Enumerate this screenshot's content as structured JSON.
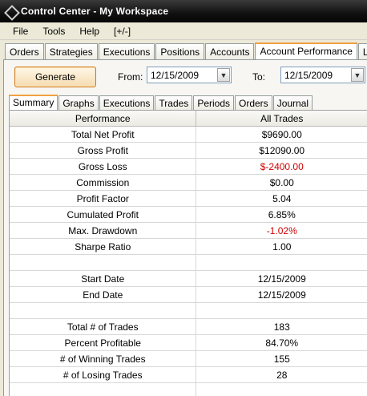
{
  "window": {
    "title": "Control Center - My Workspace"
  },
  "menu": [
    "File",
    "Tools",
    "Help",
    "[+/-]"
  ],
  "main_tabs": [
    {
      "label": "Orders",
      "active": false
    },
    {
      "label": "Strategies",
      "active": false
    },
    {
      "label": "Executions",
      "active": false
    },
    {
      "label": "Positions",
      "active": false
    },
    {
      "label": "Accounts",
      "active": false
    },
    {
      "label": "Account Performance",
      "active": true
    },
    {
      "label": "Log",
      "active": false
    }
  ],
  "toolbar": {
    "generate_label": "Generate",
    "from_label": "From:",
    "from_value": "12/15/2009",
    "to_label": "To:",
    "to_value": "12/15/2009"
  },
  "sub_tabs": [
    {
      "label": "Summary",
      "active": true
    },
    {
      "label": "Graphs",
      "active": false
    },
    {
      "label": "Executions",
      "active": false
    },
    {
      "label": "Trades",
      "active": false
    },
    {
      "label": "Periods",
      "active": false
    },
    {
      "label": "Orders",
      "active": false
    },
    {
      "label": "Journal",
      "active": false
    }
  ],
  "table": {
    "headers": [
      "Performance",
      "All Trades"
    ],
    "rows": [
      {
        "label": "Total Net Profit",
        "value": "$9690.00",
        "negative": false
      },
      {
        "label": "Gross Profit",
        "value": "$12090.00",
        "negative": false
      },
      {
        "label": "Gross Loss",
        "value": "$-2400.00",
        "negative": true
      },
      {
        "label": "Commission",
        "value": "$0.00",
        "negative": false
      },
      {
        "label": "Profit Factor",
        "value": "5.04",
        "negative": false
      },
      {
        "label": "Cumulated Profit",
        "value": "6.85%",
        "negative": false
      },
      {
        "label": "Max. Drawdown",
        "value": "-1.02%",
        "negative": true
      },
      {
        "label": "Sharpe Ratio",
        "value": "1.00",
        "negative": false
      },
      {
        "label": "",
        "value": "",
        "negative": false
      },
      {
        "label": "Start Date",
        "value": "12/15/2009",
        "negative": false
      },
      {
        "label": "End Date",
        "value": "12/15/2009",
        "negative": false
      },
      {
        "label": "",
        "value": "",
        "negative": false
      },
      {
        "label": "Total # of Trades",
        "value": "183",
        "negative": false
      },
      {
        "label": "Percent Profitable",
        "value": "84.70%",
        "negative": false
      },
      {
        "label": "# of Winning Trades",
        "value": "155",
        "negative": false
      },
      {
        "label": "# of Losing Trades",
        "value": "28",
        "negative": false
      },
      {
        "label": "",
        "value": "",
        "negative": false
      }
    ]
  },
  "colors": {
    "accent": "#f0a040",
    "negative": "#d00000"
  }
}
